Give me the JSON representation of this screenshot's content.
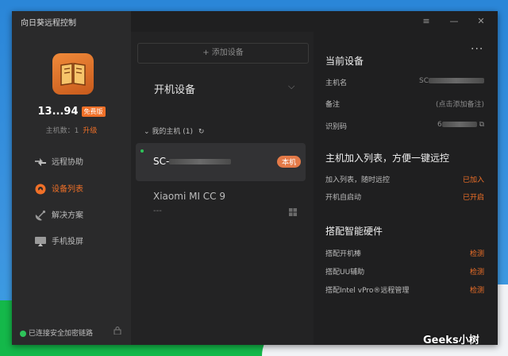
{
  "window": {
    "title": "向日葵远程控制",
    "menu_icon": "≡",
    "minimize_icon": "—",
    "close_icon": "✕"
  },
  "sidebar": {
    "user_id": "13...94",
    "plan_badge": "免费版",
    "host_count_label": "主机数：",
    "host_count": "1",
    "upgrade": "升级",
    "nav": [
      {
        "label": "远程协助",
        "icon": "remote-assist-icon",
        "active": false
      },
      {
        "label": "设备列表",
        "icon": "device-list-icon",
        "active": true
      },
      {
        "label": "解决方案",
        "icon": "satellite-icon",
        "active": false
      },
      {
        "label": "手机投屏",
        "icon": "screen-cast-icon",
        "active": false
      }
    ],
    "secure_status": "已连接安全加密链路"
  },
  "devices": {
    "add_button": "+ 添加设备",
    "section_title": "开机设备",
    "group_label": "我的主机 (1)",
    "items": [
      {
        "name": "SC-",
        "tag": "本机",
        "online": true
      },
      {
        "name": "Xiaomi MI CC 9",
        "sub": "---",
        "os_icon": "windows-icon"
      }
    ]
  },
  "current_device": {
    "title": "当前设备",
    "rows": [
      {
        "label": "主机名",
        "value": "SC"
      },
      {
        "label": "备注",
        "value": "(点击添加备注)"
      },
      {
        "label": "识别码",
        "value": "6"
      }
    ],
    "list_section": {
      "title": "主机加入列表，方便一键远控",
      "rows": [
        {
          "label": "加入列表，随时远控",
          "value": "已加入"
        },
        {
          "label": "开机自启动",
          "value": "已开启"
        }
      ]
    },
    "hardware_section": {
      "title": "搭配智能硬件",
      "rows": [
        {
          "label": "搭配开机棒",
          "value": "检测"
        },
        {
          "label": "搭配UU辅助",
          "value": "检测"
        },
        {
          "label": "搭配Intel vPro®远程管理",
          "value": "检测"
        }
      ]
    }
  },
  "watermark": "Geeks小树",
  "colors": {
    "accent": "#f07028",
    "online": "#2ec45a",
    "panel": "#1f1f20"
  }
}
